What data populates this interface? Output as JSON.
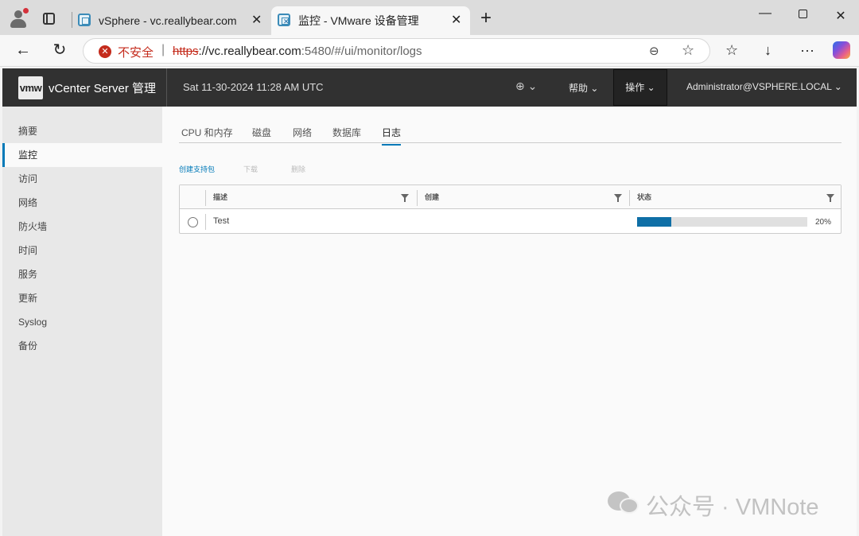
{
  "browser": {
    "tabs": [
      {
        "title": "vSphere - vc.reallybear.com - 摘要",
        "active": false
      },
      {
        "title": "监控 - VMware 设备管理",
        "active": true
      }
    ],
    "address": {
      "security_label": "不安全",
      "url_protocol": "https",
      "url_host": "://vc.reallybear.com",
      "url_path": ":5480/#/ui/monitor/logs"
    }
  },
  "header": {
    "logo": "vmw",
    "app_title": "vCenter Server 管理",
    "datetime": "Sat 11-30-2024 11:28 AM UTC",
    "help_label": "帮助",
    "actions_label": "操作",
    "user_label": "Administrator@VSPHERE.LOCAL"
  },
  "sidebar": {
    "items": [
      {
        "label": "摘要"
      },
      {
        "label": "监控",
        "active": true
      },
      {
        "label": "访问"
      },
      {
        "label": "网络"
      },
      {
        "label": "防火墙"
      },
      {
        "label": "时间"
      },
      {
        "label": "服务"
      },
      {
        "label": "更新"
      },
      {
        "label": "Syslog"
      },
      {
        "label": "备份"
      }
    ]
  },
  "monitor": {
    "tabs": [
      {
        "label": "CPU 和内存"
      },
      {
        "label": "磁盘"
      },
      {
        "label": "网络"
      },
      {
        "label": "数据库"
      },
      {
        "label": "日志",
        "active": true
      }
    ],
    "actions": {
      "create_bundle": "创建支持包",
      "download": "下载",
      "delete": "删除"
    },
    "grid": {
      "columns": [
        "描述",
        "创建",
        "状态"
      ],
      "rows": [
        {
          "description": "Test",
          "created": "",
          "progress": 0.2,
          "progress_label": "20%"
        }
      ]
    }
  },
  "watermark": {
    "text": "公众号 · VMNote"
  },
  "colors": {
    "accent": "#0079b8",
    "progress_fill": "#0f6fa6",
    "header_bg": "#313131",
    "security_red": "#c42b1c"
  }
}
